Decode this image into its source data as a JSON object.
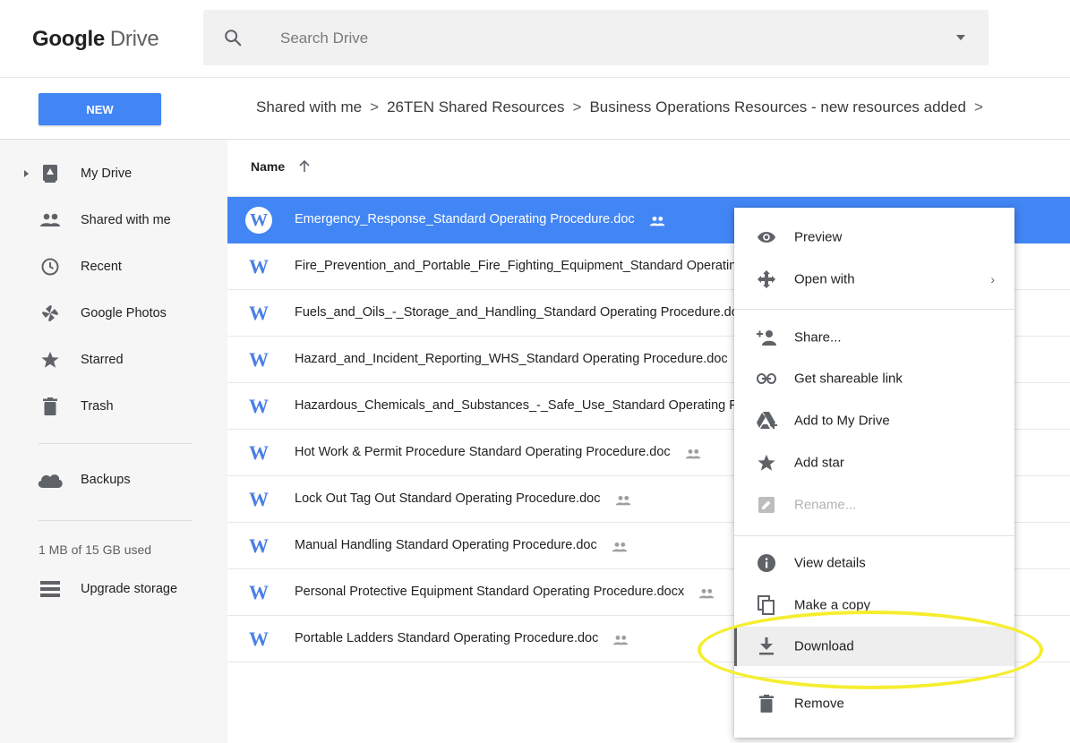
{
  "app": {
    "logo_google": "Google",
    "logo_drive": "Drive"
  },
  "search": {
    "placeholder": "Search Drive"
  },
  "toolbar": {
    "new_label": "NEW"
  },
  "breadcrumb": [
    "Shared with me",
    "26TEN Shared Resources",
    "Business Operations Resources - new resources added"
  ],
  "sidebar": {
    "items": [
      {
        "label": "My Drive",
        "icon": "my-drive-icon"
      },
      {
        "label": "Shared with me",
        "icon": "shared-people-icon"
      },
      {
        "label": "Recent",
        "icon": "clock-icon"
      },
      {
        "label": "Google Photos",
        "icon": "pinwheel-icon"
      },
      {
        "label": "Starred",
        "icon": "star-icon"
      },
      {
        "label": "Trash",
        "icon": "trash-icon"
      },
      {
        "label": "Backups",
        "icon": "cloud-icon"
      }
    ],
    "storage_text": "1 MB of 15 GB used",
    "upgrade_label": "Upgrade storage"
  },
  "list": {
    "column_name": "Name",
    "files": [
      {
        "name": "Emergency_Response_Standard Operating Procedure.doc",
        "shared": true,
        "selected": true
      },
      {
        "name": "Fire_Prevention_and_Portable_Fire_Fighting_Equipment_Standard Operating Procedure.doc",
        "shared": false,
        "selected": false
      },
      {
        "name": "Fuels_and_Oils_-_Storage_and_Handling_Standard Operating Procedure.doc",
        "shared": false,
        "selected": false
      },
      {
        "name": "Hazard_and_Incident_Reporting_WHS_Standard Operating Procedure.doc",
        "shared": false,
        "selected": false
      },
      {
        "name": "Hazardous_Chemicals_and_Substances_-_Safe_Use_Standard Operating Procedure.doc",
        "shared": false,
        "selected": false
      },
      {
        "name": "Hot Work & Permit Procedure Standard Operating Procedure.doc",
        "shared": true,
        "selected": false
      },
      {
        "name": "Lock Out Tag Out Standard Operating Procedure.doc",
        "shared": true,
        "selected": false
      },
      {
        "name": "Manual Handling Standard Operating Procedure.doc",
        "shared": true,
        "selected": false
      },
      {
        "name": "Personal Protective Equipment Standard Operating Procedure.docx",
        "shared": true,
        "selected": false
      },
      {
        "name": "Portable Ladders Standard Operating Procedure.doc",
        "shared": true,
        "selected": false
      }
    ]
  },
  "context_menu": {
    "items": [
      {
        "label": "Preview",
        "icon": "eye-icon",
        "disabled": false
      },
      {
        "label": "Open with",
        "icon": "open-with-icon",
        "disabled": false,
        "submenu": true
      },
      {
        "label": "Share...",
        "icon": "share-person-add-icon",
        "disabled": false
      },
      {
        "label": "Get shareable link",
        "icon": "link-icon",
        "disabled": false
      },
      {
        "label": "Add to My Drive",
        "icon": "add-to-drive-icon",
        "disabled": false
      },
      {
        "label": "Add star",
        "icon": "star-icon",
        "disabled": false
      },
      {
        "label": "Rename...",
        "icon": "rename-icon",
        "disabled": true
      },
      {
        "label": "View details",
        "icon": "info-icon",
        "disabled": false
      },
      {
        "label": "Make a copy",
        "icon": "copy-icon",
        "disabled": false
      },
      {
        "label": "Download",
        "icon": "download-icon",
        "disabled": false,
        "hovered": true
      },
      {
        "label": "Remove",
        "icon": "trash-icon",
        "disabled": false
      }
    ],
    "submenu_chevron": "›"
  },
  "colors": {
    "accent": "#4285f4",
    "highlight": "#f5ee30"
  }
}
